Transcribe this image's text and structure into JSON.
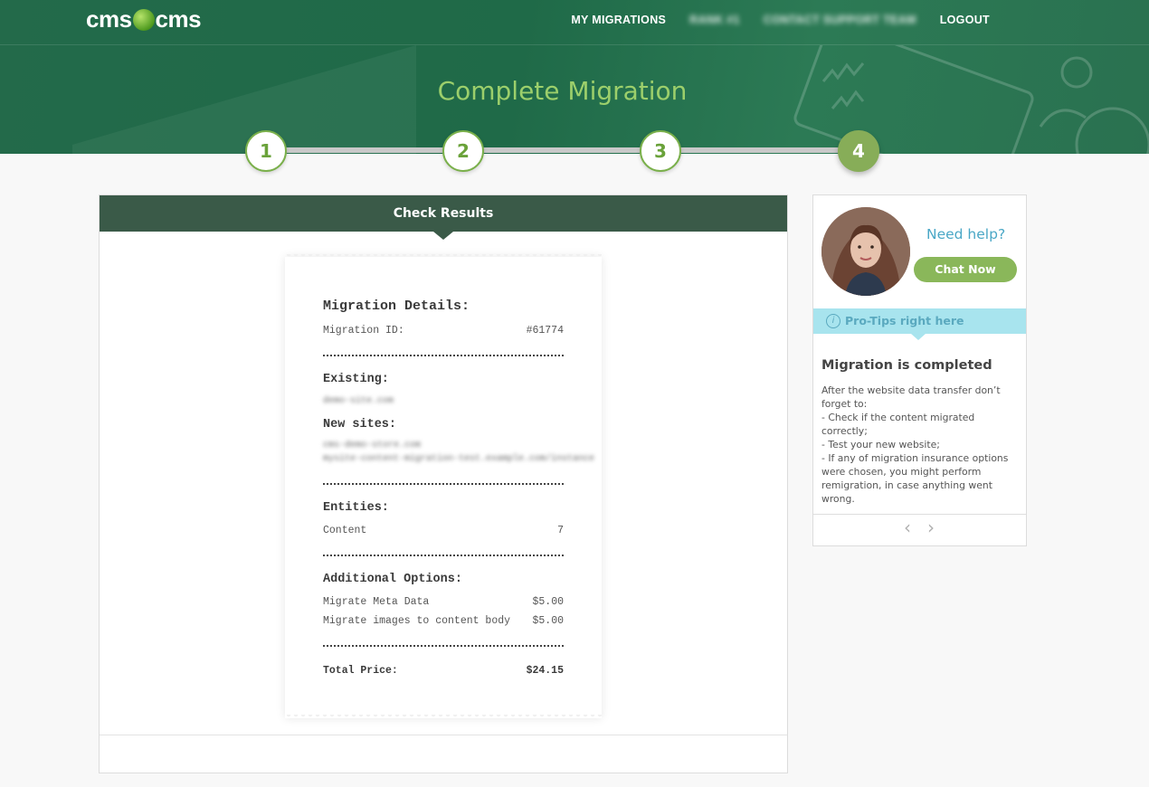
{
  "header": {
    "logo": {
      "left": "cms",
      "right": "cms"
    },
    "nav": [
      {
        "label": "MY MIGRATIONS",
        "blurred": false
      },
      {
        "label": "RANK #1",
        "blurred": true
      },
      {
        "label": "CONTACT SUPPORT TEAM",
        "blurred": true
      },
      {
        "label": "LOGOUT",
        "blurred": false
      }
    ],
    "title": "Complete Migration"
  },
  "steps": [
    {
      "label": "1",
      "active": false
    },
    {
      "label": "2",
      "active": false
    },
    {
      "label": "3",
      "active": false
    },
    {
      "label": "4",
      "active": true
    }
  ],
  "main": {
    "heading": "Check Results",
    "receipt": {
      "details_heading": "Migration Details:",
      "migration_id_label": "Migration ID:",
      "migration_id_value": "#61774",
      "existing_heading": "Existing:",
      "existing_value": "demo-site.com",
      "new_sites_heading": "New sites:",
      "new_sites_value_1": "cms-demo-store.com",
      "new_sites_value_2": "mysite-content-migration-test.example.com/instance",
      "entities_heading": "Entities:",
      "content_label": "Content",
      "content_value": "7",
      "options_heading": "Additional Options:",
      "option1_label": "Migrate Meta Data",
      "option1_value": "$5.00",
      "option2_label": "Migrate images to content body",
      "option2_value": "$5.00",
      "total_label": "Total Price:",
      "total_value": "$24.15"
    }
  },
  "side": {
    "need_help": "Need help?",
    "chat_now": "Chat Now",
    "protips": "Pro-Tips right here",
    "info_glyph": "i",
    "tip_title": "Migration is completed",
    "tip_lines": [
      "After the website data transfer don’t forget to:",
      "- Check if the content migrated correctly;",
      "- Test your new website;",
      "- If any of migration insurance options were chosen, you might perform remigration, in case anything went wrong."
    ],
    "prev_glyph": "‹",
    "next_glyph": "›"
  },
  "colors": {
    "header_green": "#236a4a",
    "title_green": "#9ccf6b",
    "panel_head": "#3a5a48",
    "accent_green": "#8ab75a",
    "help_blue": "#4aa7c6",
    "protip_bg": "#a8e4ee"
  }
}
